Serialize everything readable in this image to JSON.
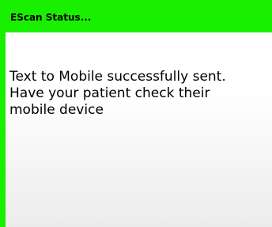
{
  "dialog": {
    "title": "EScan Status...",
    "message_lines": [
      "Text to Mobile successfully sent.",
      "Have your patient check their",
      "mobile device"
    ]
  },
  "colors": {
    "accent": "#19f000",
    "background_top": "#ffffff",
    "background_bottom": "#ececec"
  }
}
